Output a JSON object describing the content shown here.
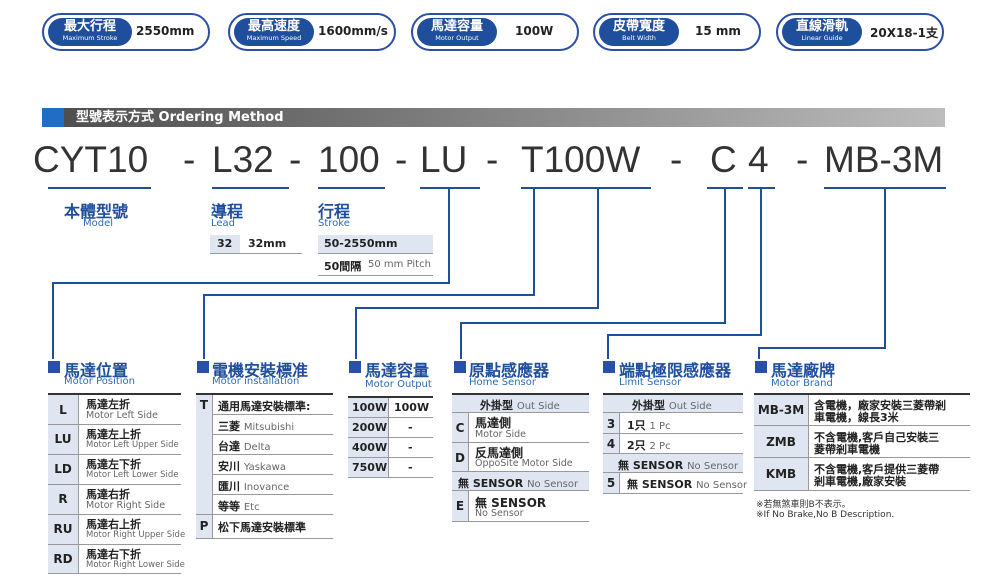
{
  "specs": [
    {
      "zh": "最大行程",
      "en": "Maximum Stroke",
      "value": "2550mm"
    },
    {
      "zh": "最高速度",
      "en": "Maximum Speed",
      "value": "1600mm/s"
    },
    {
      "zh": "馬達容量",
      "en": "Motor Output",
      "value": "100W"
    },
    {
      "zh": "皮帶寬度",
      "en": "Belt Width",
      "value": "15 mm"
    },
    {
      "zh": "直線滑軌",
      "en": "Linear Guide",
      "value": "20X18-1支"
    }
  ],
  "ordering": {
    "title": "型號表示方式 Ordering Method"
  },
  "code": {
    "model": "CYT10",
    "d1": "-",
    "lead": "L32",
    "d2": "-",
    "stroke": "100",
    "d3": "-",
    "position": "LU",
    "d4": "-",
    "installation": "T100W",
    "d5": "-",
    "sensor": "C",
    "limit": "4",
    "d6": "-",
    "brand": "MB-3M"
  },
  "model_label": {
    "zh": "本體型號",
    "en": "Model"
  },
  "lead": {
    "zh": "導程",
    "en": "Lead",
    "code": "32",
    "value": "32mm"
  },
  "stroke": {
    "zh": "行程",
    "en": "Stroke",
    "range": "50-2550mm",
    "interval_zh": "50間隔",
    "interval_en": "50 mm Pitch"
  },
  "motor_position": {
    "zh": "馬達位置",
    "en": "Motor Position",
    "rows": [
      {
        "code": "L",
        "zh": "馬達左折",
        "en": "Motor Left Side"
      },
      {
        "code": "LU",
        "zh": "馬達左上折",
        "en": "Motor Left Upper Side"
      },
      {
        "code": "LD",
        "zh": "馬達左下折",
        "en": "Motor Left Lower Side"
      },
      {
        "code": "R",
        "zh": "馬達右折",
        "en": "Motor Right Side"
      },
      {
        "code": "RU",
        "zh": "馬達右上折",
        "en": "Motor Right Upper Side"
      },
      {
        "code": "RD",
        "zh": "馬達右下折",
        "en": "Motor Right Lower Side"
      }
    ]
  },
  "motor_installation": {
    "zh": "電機安裝標准",
    "en": "Motor installation",
    "t_code": "T",
    "t_label": "通用馬達安裝標準:",
    "brands": [
      {
        "zh": "三菱",
        "en": "Mitsubishi"
      },
      {
        "zh": "台達",
        "en": "Delta"
      },
      {
        "zh": "安川",
        "en": "Yaskawa"
      },
      {
        "zh": "匯川",
        "en": "Inovance"
      },
      {
        "zh": "等等",
        "en": "Etc"
      }
    ],
    "p_code": "P",
    "p_label": "松下馬達安裝標準"
  },
  "motor_output": {
    "zh": "馬達容量",
    "en": "Motor Output",
    "rows": [
      {
        "a": "100W",
        "b": "100W"
      },
      {
        "a": "200W",
        "b": "-"
      },
      {
        "a": "400W",
        "b": "-"
      },
      {
        "a": "750W",
        "b": "-"
      }
    ]
  },
  "home_sensor": {
    "zh": "原點感應器",
    "en": "Home Sensor",
    "head_zh": "外掛型",
    "head_en": "Out Side",
    "c_code": "C",
    "c_zh": "馬達側",
    "c_en": "Motor Side",
    "d_code": "D",
    "d_zh": "反馬達側",
    "d_en": "OppoSite Motor Side",
    "no_zh": "無 SENSOR",
    "no_en": "No Sensor",
    "e_code": "E",
    "e_zh": "無 SENSOR",
    "e_en": "No Sensor"
  },
  "limit_sensor": {
    "zh": "端點極限感應器",
    "en": "Limit Sensor",
    "head_zh": "外掛型",
    "head_en": "Out Side",
    "rows": [
      {
        "code": "3",
        "zh": "1只",
        "en": "1 Pc"
      },
      {
        "code": "4",
        "zh": "2只",
        "en": "2 Pc"
      }
    ],
    "no_zh": "無 SENSOR",
    "no_en": "No Sensor",
    "five_code": "5",
    "five_zh": "無 SENSOR",
    "five_en": "No Sensor"
  },
  "motor_brand": {
    "zh": "馬達廠牌",
    "en": "Motor Brand",
    "rows": [
      {
        "code": "MB-3M",
        "l1": "含電機，廠家安裝三菱帶剎",
        "l2": "車電機，線長3米"
      },
      {
        "code": "ZMB",
        "l1": "不含電機,客戶自己安裝三",
        "l2": "菱帶剎車電機"
      },
      {
        "code": "KMB",
        "l1": "不含電機,客戶提供三菱帶",
        "l2": "剎車電機,廠家安裝"
      }
    ],
    "note1": "※若無煞車則B不表示。",
    "note2": "※If No Brake,No B Description."
  }
}
